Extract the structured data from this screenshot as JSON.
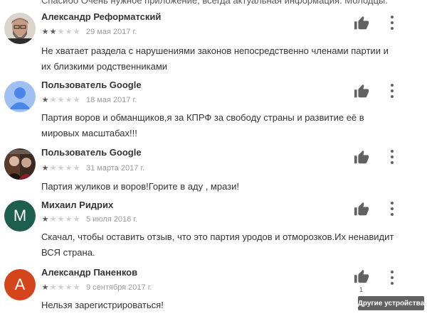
{
  "top_cutoff_text": "Спасибо Очень нужное приложение, всегда актуальная информация. Молодцы.",
  "reviews": [
    {
      "author": "Александр Реформатский",
      "stars": 2,
      "star_glyphs": [
        "★",
        "★",
        "★",
        "★",
        "★"
      ],
      "date": "29 мая 2017 г.",
      "text": "Не хватает раздела с нарушениями законов непосредственно членами партии и их близкими родственниками",
      "avatar": "photo"
    },
    {
      "author": "Пользователь Google",
      "stars": 1,
      "star_glyphs": [
        "★",
        "★",
        "★",
        "★",
        "★"
      ],
      "date": "18 мая 2017 г.",
      "text": "Партия воров и обманщиков,я за КПРФ за свободу страны и развитие её в мировых масштабах!!!",
      "avatar": "default-user"
    },
    {
      "author": "Пользователь Google",
      "stars": 1,
      "star_glyphs": [
        "★",
        "★",
        "★",
        "★",
        "★"
      ],
      "date": "31 марта 2017 г.",
      "text": "Партия жуликов и воров!Горите в аду , мрази!",
      "avatar": "photo"
    },
    {
      "author": "Михаил Ридрих",
      "stars": 1,
      "star_glyphs": [
        "★",
        "★",
        "★",
        "★",
        "★"
      ],
      "date": "5 июля 2016 г.",
      "text": "Скачал, чтобы оставить отзыв, что это партия уродов и отморозков.Их ненавидит ВСЯ страна.",
      "avatar": "letter",
      "avatar_letter": "M",
      "avatar_color": "#1e5e4e"
    },
    {
      "author": "Александр Паненков",
      "stars": 1,
      "star_glyphs": [
        "★",
        "★",
        "★",
        "★",
        "★"
      ],
      "date": "9 сентября 2017 г.",
      "text": "Нельзя зарегистрироваться!",
      "avatar": "letter",
      "avatar_letter": "A",
      "avatar_color": "#d5451c",
      "like_count": "1"
    }
  ],
  "tooltip": "Другие устройства",
  "colors": {
    "star_on": "#5a5a5a",
    "star_off": "#cfcfcf",
    "default_avatar_bg": "#9fc0f0",
    "default_avatar_fg": "#4a86e8"
  },
  "icons": {
    "helpful": "thumb-up-icon",
    "menu": "more-vert-icon"
  }
}
